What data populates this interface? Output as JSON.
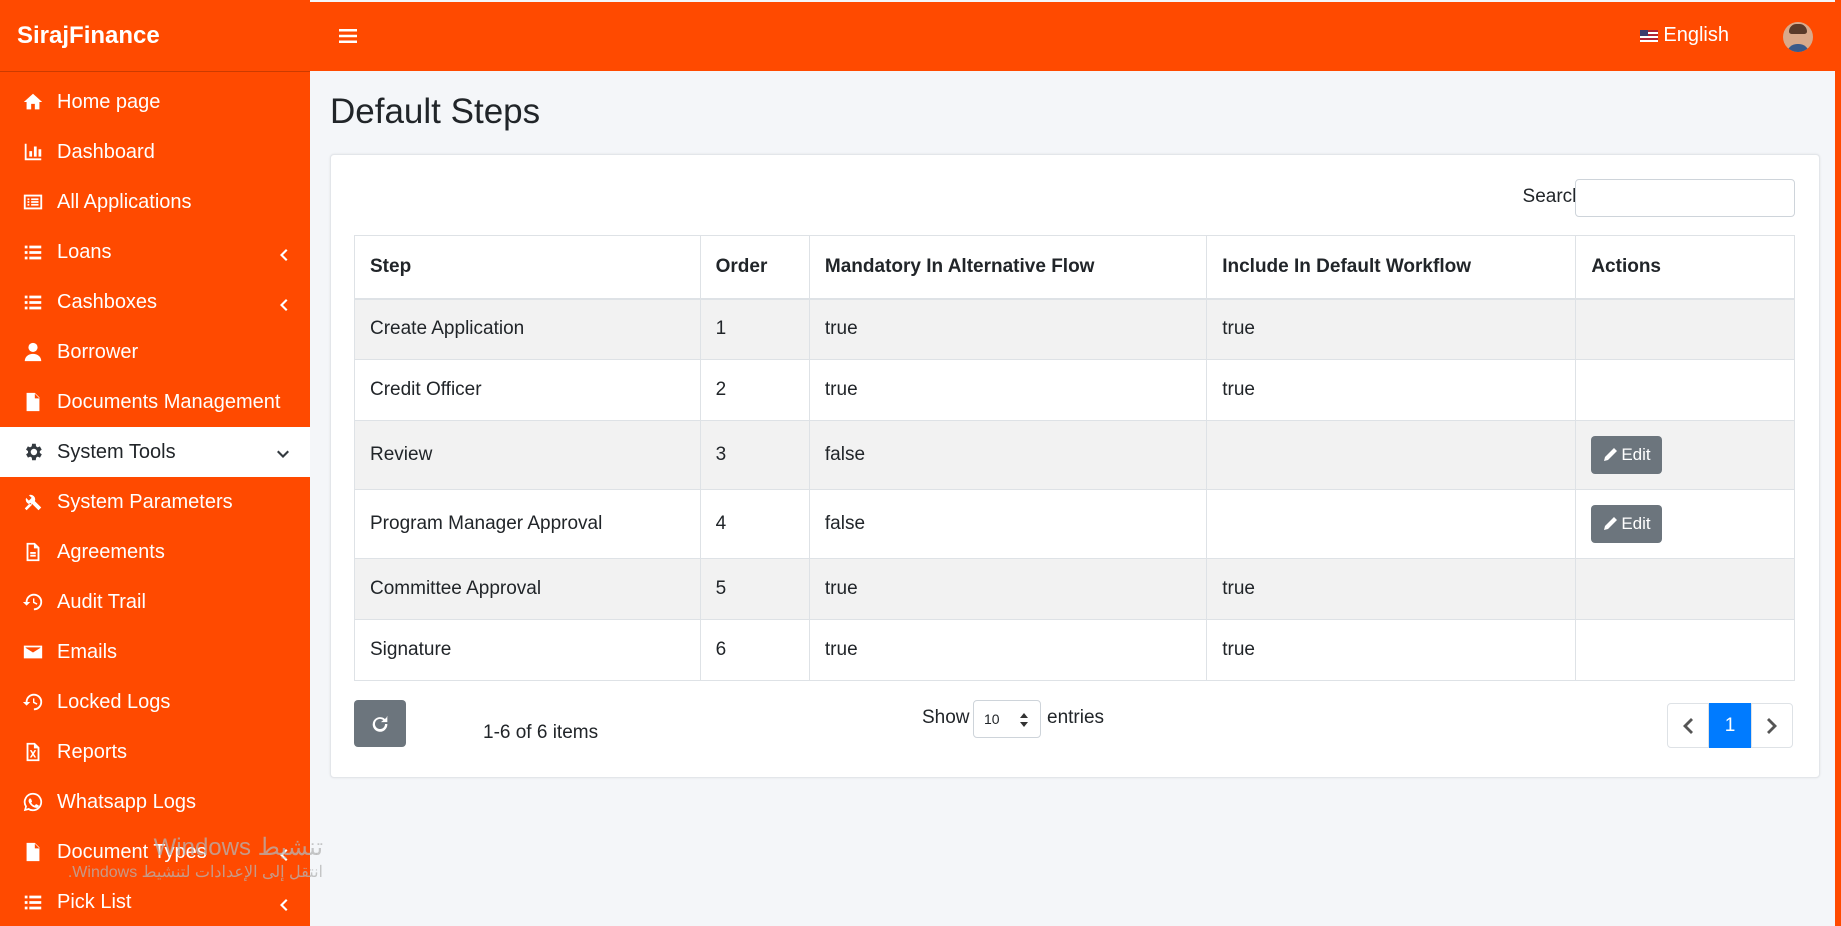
{
  "brand": "SirajFinance",
  "sidebar": {
    "items": [
      {
        "label": "Home page",
        "icon": "home-icon"
      },
      {
        "label": "Dashboard",
        "icon": "chart-bar-icon"
      },
      {
        "label": "All Applications",
        "icon": "list-alt-icon"
      },
      {
        "label": "Loans",
        "icon": "list-icon"
      },
      {
        "label": "Cashboxes",
        "icon": "list-icon"
      },
      {
        "label": "Borrower",
        "icon": "user-icon"
      },
      {
        "label": "Documents Management",
        "icon": "file-icon"
      },
      {
        "label": "System Tools",
        "icon": "gear-icon"
      },
      {
        "label": "System Parameters",
        "icon": "tools-icon"
      },
      {
        "label": "Agreements",
        "icon": "file-contract-icon"
      },
      {
        "label": "Audit Trail",
        "icon": "history-icon"
      },
      {
        "label": "Emails",
        "icon": "envelope-icon"
      },
      {
        "label": "Locked Logs",
        "icon": "history-icon"
      },
      {
        "label": "Reports",
        "icon": "file-excel-icon"
      },
      {
        "label": "Whatsapp Logs",
        "icon": "whatsapp-icon"
      },
      {
        "label": "Document Types",
        "icon": "file-icon"
      },
      {
        "label": "Pick List",
        "icon": "list-icon"
      }
    ]
  },
  "topbar": {
    "language": "English"
  },
  "page": {
    "title": "Default Steps"
  },
  "search": {
    "label": "Search:",
    "value": ""
  },
  "table": {
    "columns": [
      "Step",
      "Order",
      "Mandatory In Alternative Flow",
      "Include In Default Workflow",
      "Actions"
    ],
    "rows": [
      {
        "step": "Create Application",
        "order": "1",
        "mandatory": "true",
        "include": "true",
        "action": ""
      },
      {
        "step": "Credit Officer",
        "order": "2",
        "mandatory": "true",
        "include": "true",
        "action": ""
      },
      {
        "step": "Review",
        "order": "3",
        "mandatory": "false",
        "include": "",
        "action": "Edit"
      },
      {
        "step": "Program Manager Approval",
        "order": "4",
        "mandatory": "false",
        "include": "",
        "action": "Edit"
      },
      {
        "step": "Committee Approval",
        "order": "5",
        "mandatory": "true",
        "include": "true",
        "action": ""
      },
      {
        "step": "Signature",
        "order": "6",
        "mandatory": "true",
        "include": "true",
        "action": ""
      }
    ]
  },
  "footer": {
    "items_count": "1-6 of 6 items",
    "show_label": "Show",
    "page_size": "10",
    "entries_label": "entries",
    "current_page": "1"
  },
  "watermark": {
    "line1": "تنشيط Windows",
    "line2": "انتقل إلى الإعدادات لتنشيط Windows."
  }
}
